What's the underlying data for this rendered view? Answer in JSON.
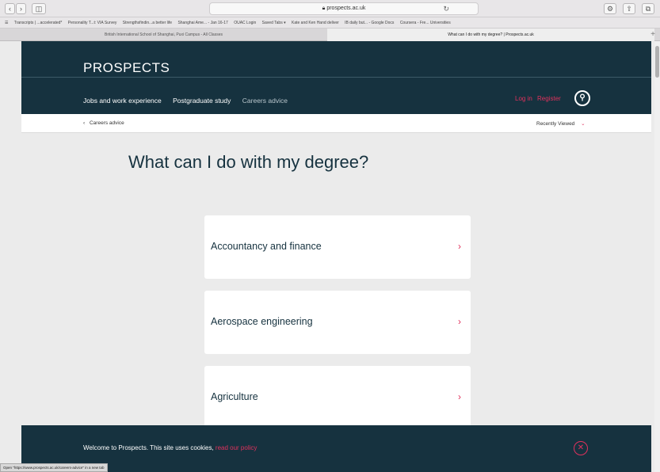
{
  "browser": {
    "url": "prospects.ac.uk",
    "bookmarks": [
      "Transcripts | ...accelerated*",
      "Personality T...t: VIA Survey",
      "Strengthsfindin...a better life",
      "Shanghai Ame... - Jan 16-17",
      "OUAC Login",
      "Saved Tabs ▾",
      "Kate and Ken Hand deliver",
      "IB daily but... - Google Docs",
      "Coursera - Fre... Universities"
    ],
    "tabs": [
      "British International School of Shanghai, Puxi Campus - All Classes",
      "What can I do with my degree? | Prospects.ac.uk"
    ]
  },
  "header": {
    "logo": "PROSPECTS",
    "nav": [
      "Jobs and work experience",
      "Postgraduate study",
      "Careers advice"
    ],
    "login": "Log in",
    "register": "Register"
  },
  "breadcrumb": {
    "prefix": "‹",
    "label": "Careers advice",
    "recent": "Recently Viewed",
    "recent_chev": "⌄"
  },
  "main": {
    "title": "What can I do with my degree?",
    "subjects": [
      "Accountancy and finance",
      "Aerospace engineering",
      "Agriculture"
    ]
  },
  "cookie": {
    "text": "Welcome to Prospects. This site uses cookies,",
    "link": "read our policy"
  },
  "status_tip": "Open \"https://www.prospects.ac.uk/careers-advice\" in a new tab",
  "colors": {
    "navy": "#16323f",
    "accent": "#e0315d"
  }
}
